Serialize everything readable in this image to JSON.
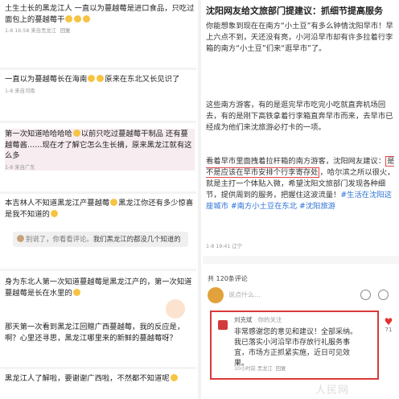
{
  "left": {
    "c1": {
      "text": "土生土长的黑龙江人 一直以为蔓越莓是进口食品，只吃过面包上的蔓越莓干",
      "meta": "1-8 16:58 来自黑龙江",
      "reply": "回复"
    },
    "c2": {
      "text": "一直以为蔓越莓长在海南",
      "text2": "原来在东北又长见识了",
      "meta": "1-8 来自河南"
    },
    "c3": {
      "text": "第一次知道哈哈哈哈",
      "text2": "以前只吃过蔓越莓干制品 还有蔓越莓酱……现在才了解它怎么生长摘，原来黑龙江就有这么多",
      "meta": "1-8 来自广东"
    },
    "c4": {
      "text": "本吉林人不知道黑龙江产蔓越莓",
      "text2": "黑龙江你还有多少惊喜是我不知道的",
      "reply_name": "别说了，你看看评论。",
      "reply_text": "我们黑龙江的都没几个知道的"
    },
    "c5": {
      "text": "身为东北人第一次知道蔓越莓是黑龙江产的，第一次知道蔓越莓是长在水里的",
      "text2": "那天第一次看到黑龙江回赠广西蔓越莓，我的反应是，啊？心里还寻思，黑龙江哪里来的新鲜的蔓越莓呀？",
      "text3": "黑龙江人了解啦，要谢谢广西啦，不然都不知道呢"
    }
  },
  "right": {
    "title": "沈阳网友给文旅部门提建议：抓细节提高服务",
    "p1": "你能想象到现在在南方“小土豆”有多么钟情沈阳早市！早上六点不到，天还没有亮，小河沿早市却有许多拉着行李箱的南方“小土豆”们来“逛早市”了。",
    "p2": "这些南方游客，有的是逛完早市吃完小吃就直奔机场回去，有的是刚下高铁拿着行李箱直奔早市而来，去早市已经成为他们来沈旅游必打卡的一项。",
    "p3_a": "看着早市里面拽着拉杆箱的南方游客，沈阳网友建议：",
    "p3_hl": "是不是应该在早市安排个行李寄存处",
    "p3_b": "，哈尔滨之所以很火，就是主打一个体贴入微，希望沈阳文旅部门发现各种细节，提供周到的服务，把握住这波流量！",
    "tags": "#生活在沈阳这座城市 #南方小土豆在东北 #沈阳旅游",
    "meta": "1-8 19:41 辽宁",
    "comment_count": "共 120条评论",
    "input_placeholder": "说点什么...",
    "official": {
      "name": "刘克斌",
      "follow": "你的关注",
      "text": "非常感谢您的意见和建议！全部采纳。我已落实小河沿早市存放行礼服务事宜，市场方正抓紧实施，近日可见效果。",
      "meta": "10小时前 黑龙江",
      "reply": "回复",
      "likes": "71"
    },
    "watermark": "人民网"
  },
  "colors": {
    "accent_red": "#d93a3a",
    "link_blue": "#2a6fd6"
  }
}
